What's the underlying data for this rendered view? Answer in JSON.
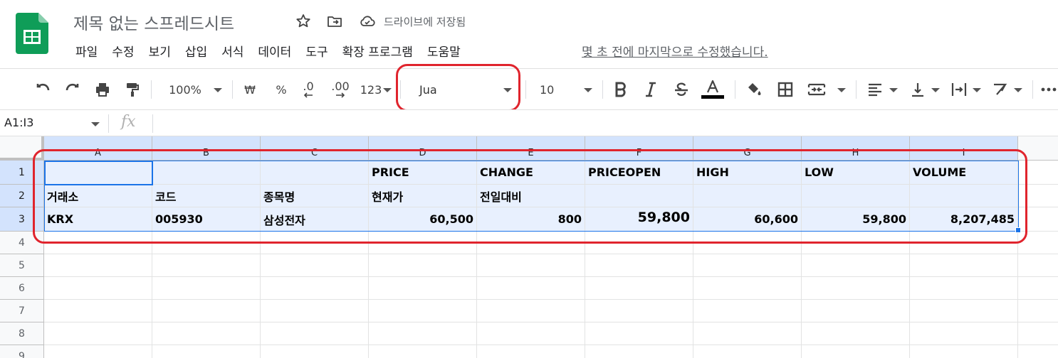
{
  "app": {
    "title": "제목 없는 스프레드시트",
    "drive_status": "드라이브에 저장됨",
    "last_edit": "몇 초 전에 마지막으로 수정했습니다.",
    "menu": [
      "파일",
      "수정",
      "보기",
      "삽입",
      "서식",
      "데이터",
      "도구",
      "확장 프로그램",
      "도움말"
    ]
  },
  "toolbar": {
    "zoom": "100%",
    "currency": "₩",
    "percent": "%",
    "dec_decrease": ".0",
    "dec_increase": ".00",
    "format": "123",
    "font": "Jua",
    "font_size": "10"
  },
  "formula_bar": {
    "name_box": "A1:I3",
    "fx": "fx",
    "content": ""
  },
  "sheet": {
    "columns": [
      "A",
      "B",
      "C",
      "D",
      "E",
      "F",
      "G",
      "H",
      "I"
    ],
    "rows": [
      "1",
      "2",
      "3",
      "4",
      "5",
      "6",
      "7",
      "8",
      "9"
    ],
    "cells": [
      [
        "",
        "",
        "",
        "PRICE",
        "CHANGE",
        "PRICEOPEN",
        "HIGH",
        "LOW",
        "VOLUME"
      ],
      [
        "거래소",
        "코드",
        "종목명",
        "현재가",
        "전일대비",
        "",
        "",
        "",
        ""
      ],
      [
        "KRX",
        "005930",
        "삼성전자",
        "60,500",
        "800",
        "59,800",
        "60,600",
        "59,800",
        "8,207,485"
      ]
    ],
    "selected_range": "A1:I3"
  },
  "colors": {
    "selection_bg": "#e8f0fe",
    "selection_border": "#1a73e8",
    "annotation": "#e0242d",
    "logo_green": "#0f9d58"
  }
}
